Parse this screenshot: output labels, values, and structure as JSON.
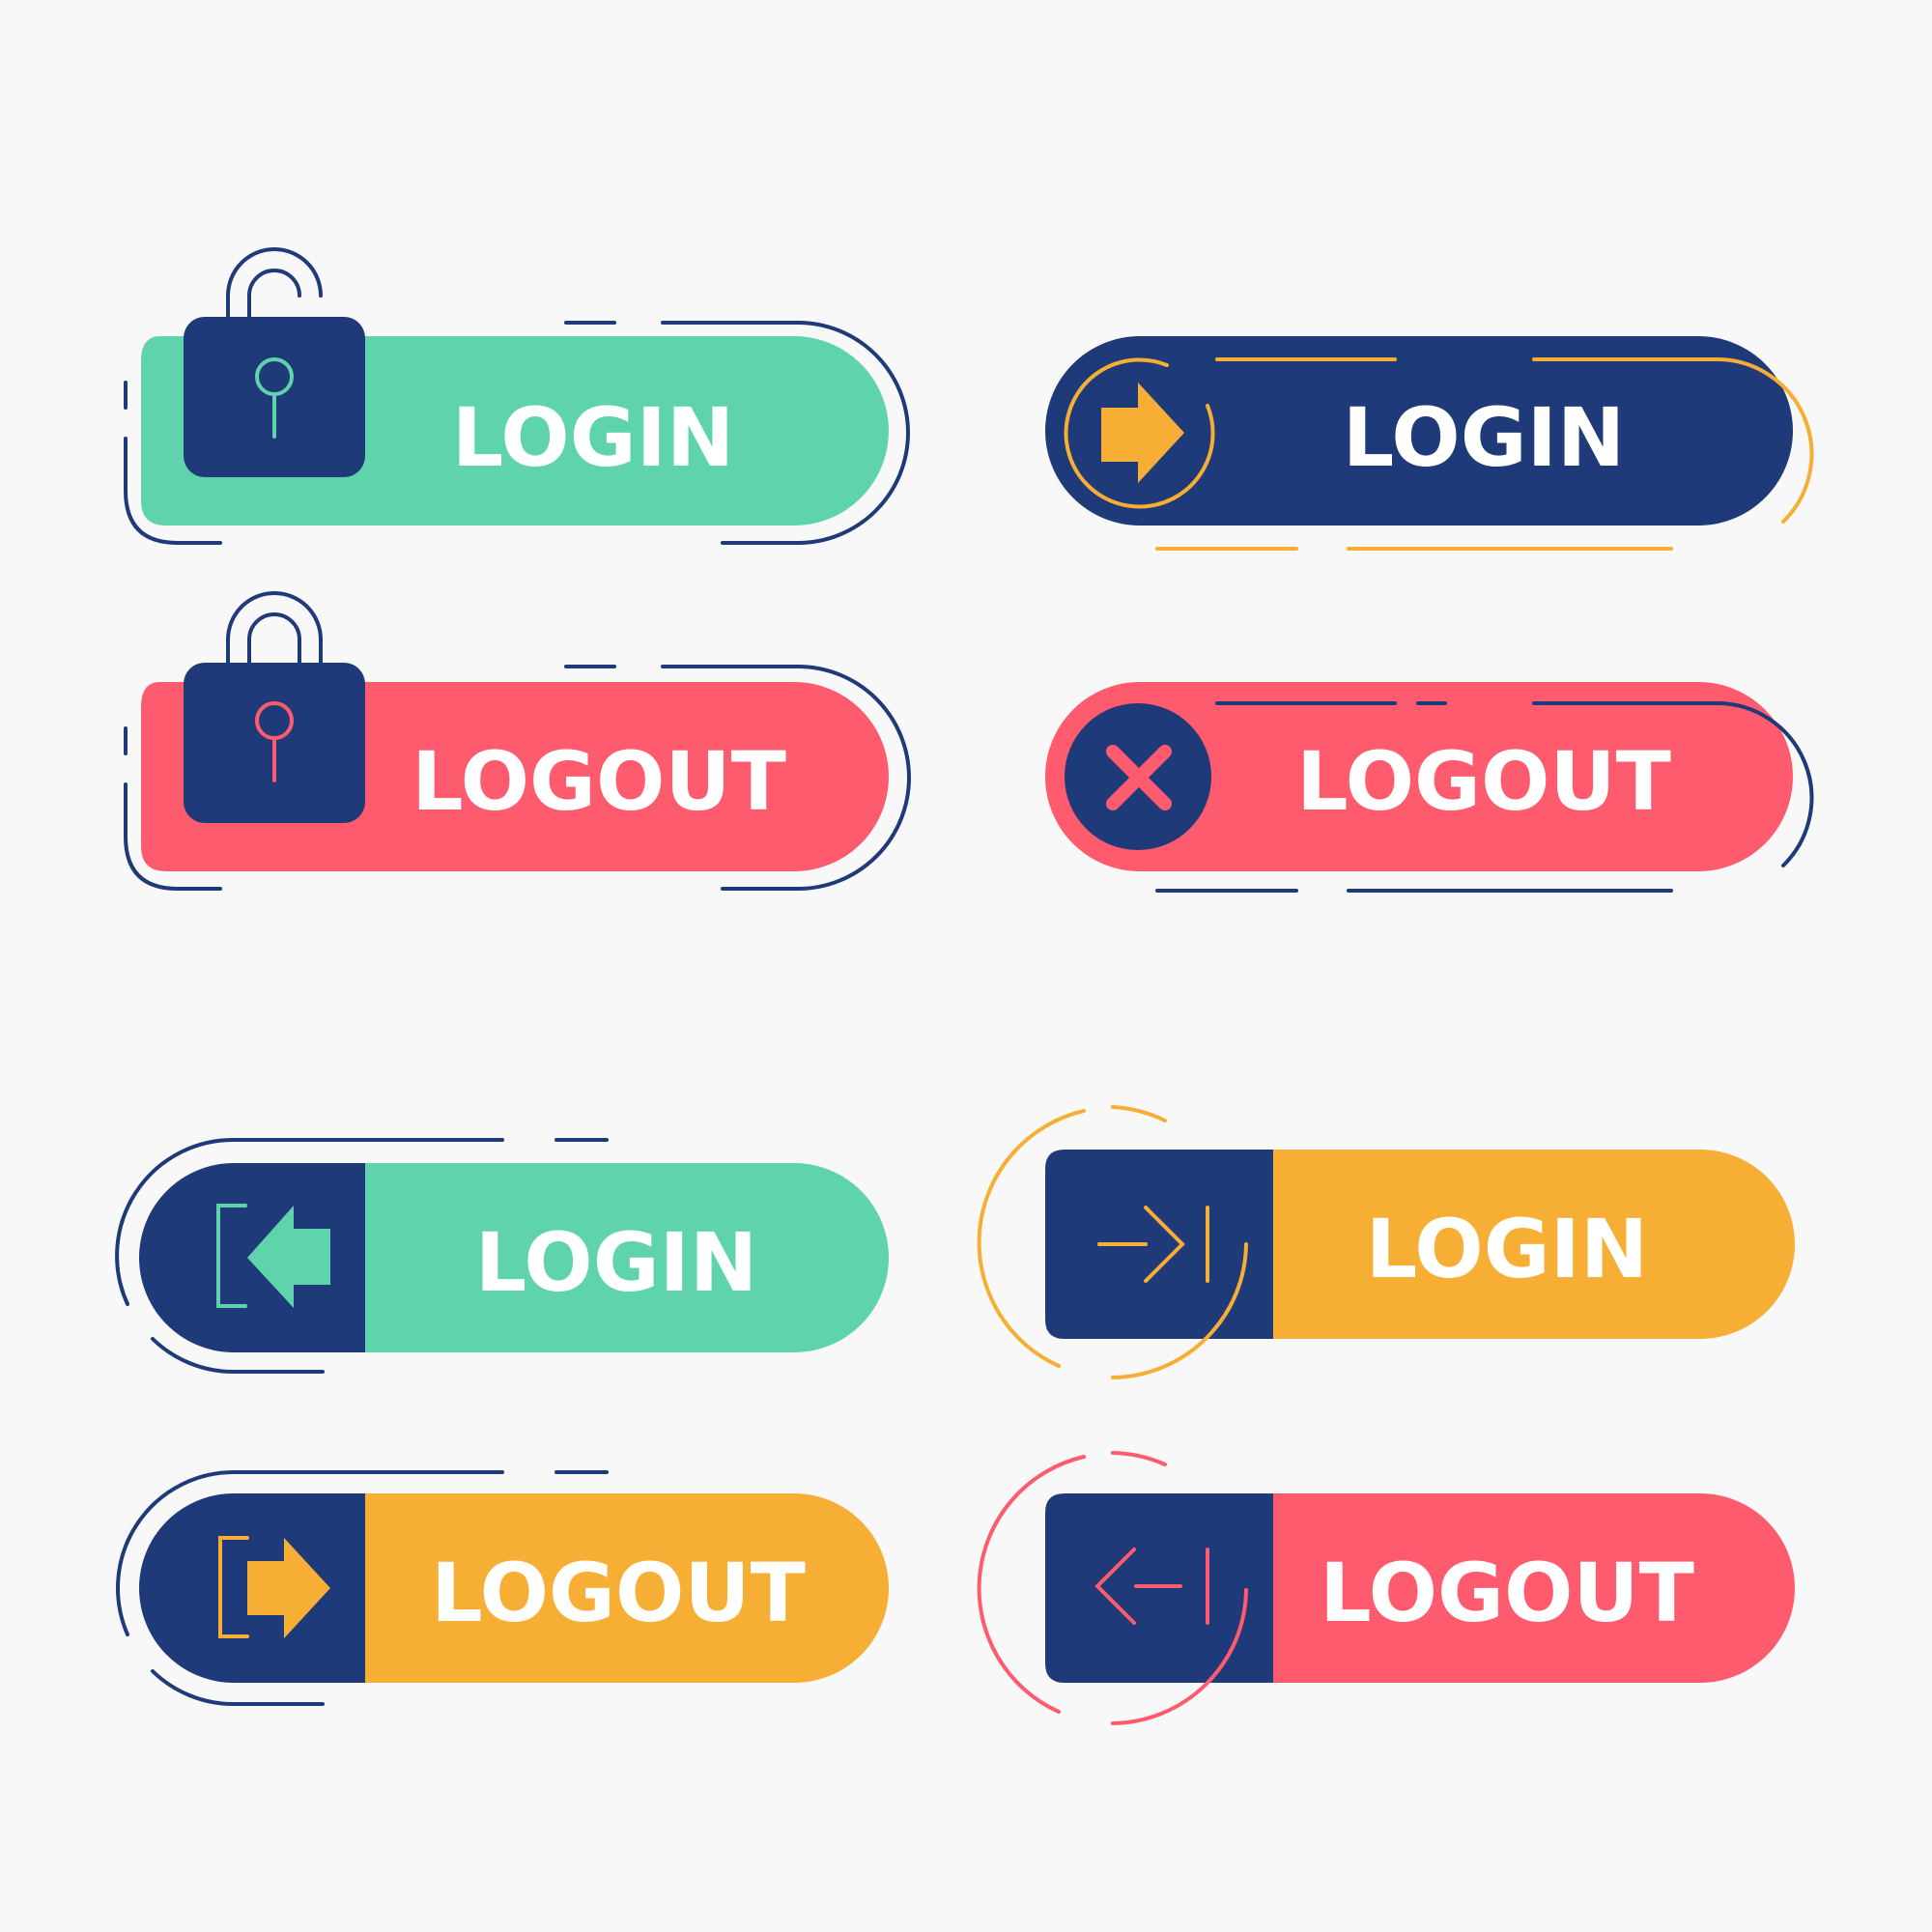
{
  "colors": {
    "background": "#f8f8f8",
    "navy": "#1f3a78",
    "mint": "#5fd3ab",
    "coral": "#ff5b6e",
    "orange": "#f7ae35",
    "white": "#ffffff"
  },
  "buttons": [
    {
      "label": "LOGIN",
      "style": "padlock-open",
      "fill": "#5fd3ab",
      "icon": "padlock-open-icon"
    },
    {
      "label": "LOGIN",
      "style": "arrow-circle",
      "fill": "#1f3a78",
      "icon": "arrow-right-circle-icon"
    },
    {
      "label": "LOGOUT",
      "style": "padlock-closed",
      "fill": "#ff5b6e",
      "icon": "padlock-closed-icon"
    },
    {
      "label": "LOGOUT",
      "style": "x-circle",
      "fill": "#ff5b6e",
      "icon": "close-circle-icon"
    },
    {
      "label": "LOGIN",
      "style": "door-enter",
      "fill": "#5fd3ab",
      "icon": "enter-door-icon"
    },
    {
      "label": "LOGIN",
      "style": "arrow-bar-in",
      "fill": "#f7ae35",
      "icon": "arrow-to-bar-icon"
    },
    {
      "label": "LOGOUT",
      "style": "door-exit",
      "fill": "#f7ae35",
      "icon": "exit-door-icon"
    },
    {
      "label": "LOGOUT",
      "style": "arrow-bar-out",
      "fill": "#ff5b6e",
      "icon": "arrow-from-bar-icon"
    }
  ]
}
